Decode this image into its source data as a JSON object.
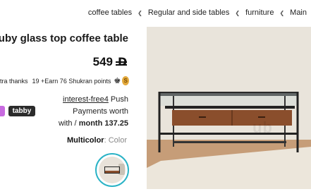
{
  "breadcrumb": {
    "items": [
      "coffee tables",
      "Regular and side tables",
      "furniture",
      "Main"
    ],
    "separator_icon": "chevron-left-icon"
  },
  "product": {
    "title": "Ruby glass top coffee table",
    "price": "549",
    "currency_icon": "dirham-currency-icon",
    "image_alt_icon": "coffee-table-photo"
  },
  "rewards": {
    "text_left": "tra thanks",
    "text_right": "19 +Earn 76 Shukran points",
    "crown_icon": "crown-icon",
    "coin_label": "S"
  },
  "installments": {
    "provider": "tabby",
    "link_text": "interest-free4",
    "line1_suffix": "Push",
    "line2": "Payments worth",
    "line3_prefix": "with /",
    "line3_amount": "month 137.25"
  },
  "variant": {
    "label": "Multicolor",
    "sep": ":",
    "value": "Color"
  },
  "colors": {
    "accent": "#2bb3c6",
    "tabby_bg": "#2b2b2b",
    "pink_tab": "#c86be0",
    "coin": "#e3a93c"
  }
}
